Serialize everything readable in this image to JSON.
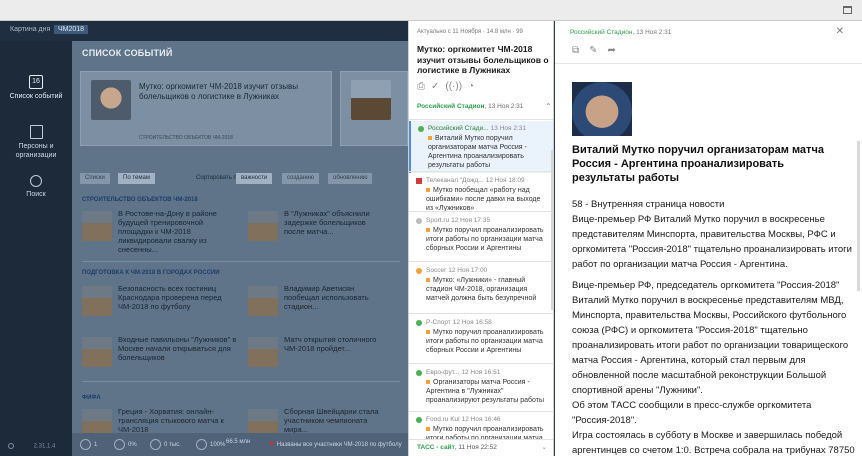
{
  "app": {
    "crumbs": [
      "Картина дня",
      "ЧМ2018"
    ],
    "nav": [
      {
        "label": "Список событий",
        "icon": "calendar-icon",
        "badge": "16"
      },
      {
        "label": "Персоны и организации",
        "icon": "book-icon"
      },
      {
        "label": "Поиск",
        "icon": "search-icon"
      }
    ],
    "version": "2.31.1.4",
    "page_title": "СПИСОК СОБЫТИЙ",
    "hero": [
      {
        "title": "Мутко: оргкомитет ЧМ-2018 изучит отзывы болельщиков о логистике в Лужниках",
        "meta": "СТРОИТЕЛЬСТВО ОБЪЕКТОВ ЧМ-2018"
      },
      {
        "title": "",
        "meta": ""
      }
    ],
    "filters": {
      "tabs": [
        "Списки",
        "По темам"
      ],
      "sort_label": "Сортировать по",
      "sort_options": [
        "важности",
        "созданию",
        "обновлению"
      ]
    },
    "sections": [
      {
        "title": "СТРОИТЕЛЬСТВО ОБЪЕКТОВ ЧМ-2018",
        "items": [
          "В Ростове-на-Дону в районе будущей тренировочной площадки к ЧМ-2018 ликвидировали свалку из снесенны...",
          "В \"Лужниках\" объяснили задержке болельщиков после матча..."
        ]
      },
      {
        "title": "ПОДГОТОВКА К ЧМ-2018 В ГОРОДАХ РОССИИ",
        "items": [
          "Безопасность всех гостиниц Краснодара проверена перед ЧМ-2018 по футболу",
          "Владимир Аветисян пообещал использовать стадион...",
          "Входные павильоны \"Лужников\" в Москве начали открываться для болельщиков",
          "Матч открытия столичного ЧМ-2018 пройдет..."
        ]
      },
      {
        "title": "ФИФА",
        "items": [
          "Греция - Хорватия: онлайн-трансляция стыкового матча к ЧМ-2018",
          "Сборная Швейцарии стала участником чемпионата мира..."
        ]
      }
    ],
    "bottom": {
      "b1": "1",
      "b2": "0%",
      "b3": "0 тыс.",
      "b4": "100%",
      "b5": "66.5 млн",
      "ticker": "Названы все участники ЧМ-2018 по футболу"
    }
  },
  "middle": {
    "meta": "Актуально с 11 Ноября  ·  14.8 млн  ·  99",
    "title": "Мутко: оргкомитет ЧМ-2018 изучит отзывы болельщиков о логистике в Лужниках",
    "tools": [
      "print-icon",
      "check-icon",
      "broadcast-icon",
      "gauge-icon"
    ],
    "source": "Российский Стадион",
    "source_time": "13 Ноя 2:31",
    "items": [
      {
        "src": "Российский Стади...",
        "time": "13 Ноя 2:31",
        "text": "Виталий Мутко поручил организаторам матча Россия - Аргентина проанализировать результаты работы",
        "icon": "green",
        "selected": true
      },
      {
        "src": "Телеканал \"Дожд...",
        "time": "12 Ноя 18:09",
        "text": "Мутко пообещал «работу над ошибками» после давки на выходе из «Лужников»",
        "icon": "red"
      },
      {
        "src": "Sport.ru",
        "time": "12 Ноя 17:35",
        "text": "Мутко поручил проанализировать итоги работы по организации матча сборных России и Аргентины",
        "icon": "gray"
      },
      {
        "src": "Soccer",
        "time": "12 Ноя 17:00",
        "text": "Мутко: «Лужники» - главный стадион ЧМ-2018, организация матчей должна быть безупречной",
        "icon": "orange"
      },
      {
        "src": "Р-Спорт",
        "time": "12 Ноя 16:58",
        "text": "Мутко поручил проанализировать итоги работы по организации матча сборных России и Аргентины",
        "icon": "green"
      },
      {
        "src": "Евро-фут...",
        "time": "12 Ноя 16:51",
        "text": "Организаторы матча Россия - Аргентина в \"Лужниках\" проанализируют результаты работы",
        "icon": "green"
      },
      {
        "src": "Food.ru Kul",
        "time": "12 Ноя 16:46",
        "text": "Мутко поручил проанализировать итоги работы по организации матча сборных России и Аргентины",
        "icon": "green"
      }
    ],
    "footer_src": "ТАСС - сайт",
    "footer_time": "11 Ноя 22:52"
  },
  "article": {
    "source": "Российский Стадион",
    "time": "13 Ноя 2:31",
    "tools": [
      "open-external-icon",
      "edit-icon",
      "share-icon"
    ],
    "title": "Виталий Мутко поручил организаторам матча Россия - Аргентина проанализировать результаты работы",
    "page_ref": "58 - Внутренняя страница новости",
    "p1": "Вице-премьер РФ Виталий Мутко поручил в воскресенье представителям Минспорта, правительства Москвы, РФС и оргкомитета \"Россия-2018\" тщательно проанализировать итоги работ по организации матча Россия - Аргентина.",
    "p2": "Вице-премьер РФ, председатель оргкомитета \"Россия-2018\" Виталий Мутко поручил в воскресенье представителям МВД, Минспорта, правительства Москвы, Российского футбольного союза (РФС) и оргкомитета \"Россия-2018\" тщательно проанализировать итоги работ по организации товарищеского матча Россия - Аргентина, который стал первым для обновленной после масштабной реконструкции Большой спортивной арены \"Лужники\".",
    "p3": "Об этом ТАСС сообщили в пресс-службе оргкомитета \"Россия-2018\".",
    "p4": "Игра состоялась в субботу в Москве и завершилась победой аргентинцев со счетом 1:0. Встреча собрала на трибунах 78750"
  }
}
